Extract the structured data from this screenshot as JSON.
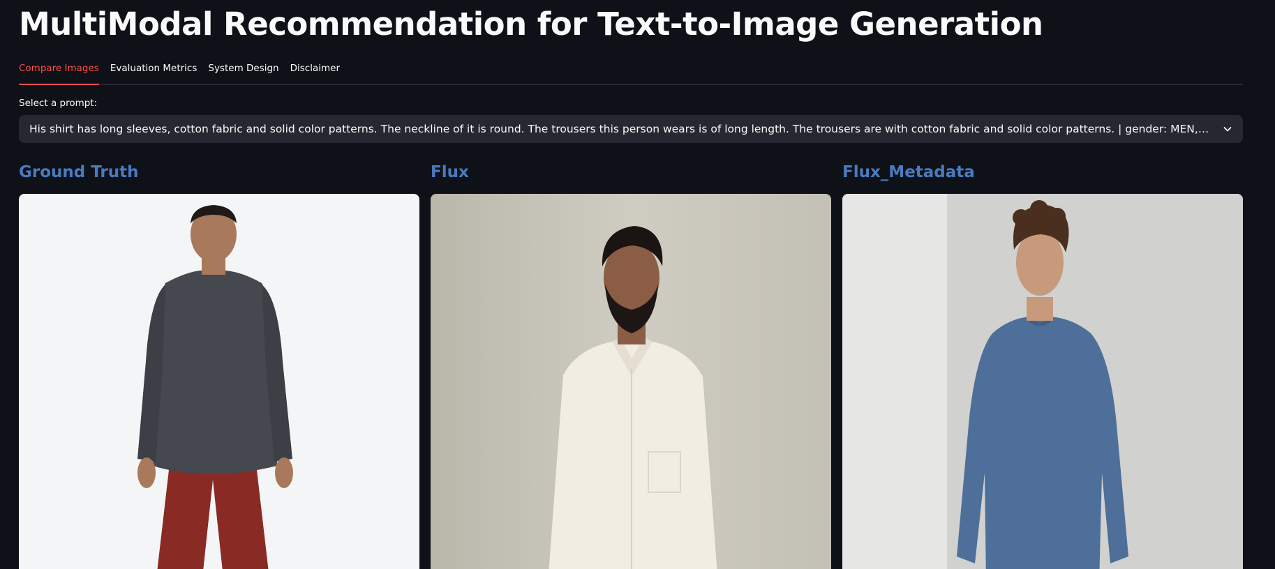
{
  "header": {
    "title": "MultiModal Recommendation for Text-to-Image Generation"
  },
  "tabs": [
    {
      "label": "Compare Images",
      "active": true
    },
    {
      "label": "Evaluation Metrics",
      "active": false
    },
    {
      "label": "System Design",
      "active": false
    },
    {
      "label": "Disclaimer",
      "active": false
    }
  ],
  "prompt_select": {
    "label": "Select a prompt:",
    "value": "His shirt has long sleeves, cotton fabric and solid color patterns. The neckline of it is round. The trousers this person wears is of long length. The trousers are with cotton fabric and solid color patterns. | gender: MEN, category: Denim, view: additional, slee…"
  },
  "columns": [
    {
      "heading": "Ground Truth",
      "image_alt": "man in dark grey long-sleeve shirt and red trousers"
    },
    {
      "heading": "Flux",
      "image_alt": "bearded man in white button-up shirt"
    },
    {
      "heading": "Flux_Metadata",
      "image_alt": "curly-haired man in blue long-sleeve shirt"
    }
  ],
  "colors": {
    "background": "#0e1117",
    "accent": "#ff4b4b",
    "heading_blue": "#4a7bc0",
    "input_bg": "#262730"
  }
}
